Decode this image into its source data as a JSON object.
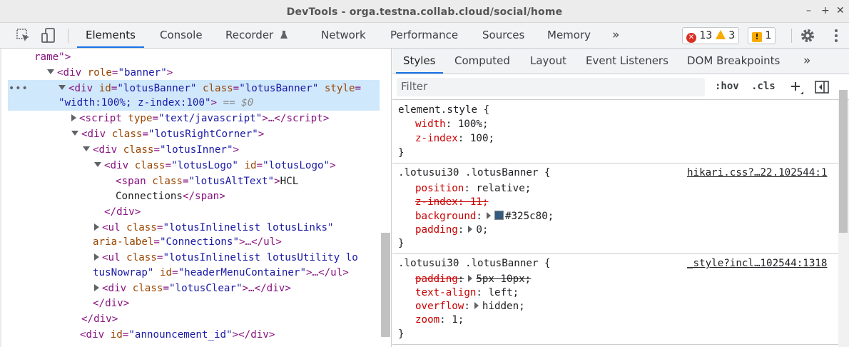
{
  "window": {
    "title": "DevTools - orga.testna.collab.cloud/social/home"
  },
  "toolbar": {
    "tabs": [
      "Elements",
      "Console",
      "Recorder",
      "Network",
      "Performance",
      "Sources",
      "Memory"
    ],
    "more": "»",
    "errors": "13",
    "warnings": "3",
    "issues": "1"
  },
  "elements": {
    "lines": {
      "l0": "rame\">",
      "banner_attr": "role",
      "banner_val": "\"banner\"",
      "sel_id_attr": "id",
      "sel_id_val": "\"lotusBanner\"",
      "sel_class_attr": "class",
      "sel_class_val": "\"lotusBanner\"",
      "sel_style_attr": "style",
      "sel_style_val": "\"width:100%; z-index:100\"",
      "sel_eq": "== $0",
      "script_attr": "type",
      "script_val": "\"text/javascript\"",
      "rc_val": "\"lotusRightCorner\"",
      "inner_val": "\"lotusInner\"",
      "logo_class": "\"lotusLogo\"",
      "logo_id": "\"lotusLogo\"",
      "span_class": "\"lotusAltText\"",
      "hcl_text_1": "HCL",
      "hcl_text_2": "Connections",
      "ul1_class": "\"lotusInlinelist lotusLinks\"",
      "ul1_aria": "aria-label",
      "ul1_aria_val": "\"Connections\"",
      "ul2_class_1": "\"lotusInlinelist lotusUtility lo",
      "ul2_class_2": "tusNowrap\"",
      "ul2_id": "\"headerMenuContainer\"",
      "clear_class": "\"lotusClear\"",
      "ann_id": "\"announcement_id\""
    }
  },
  "styles": {
    "tabs": [
      "Styles",
      "Computed",
      "Layout",
      "Event Listeners",
      "DOM Breakpoints"
    ],
    "more": "»",
    "filter_placeholder": "Filter",
    "hov": ":hov",
    "cls": ".cls",
    "rules": {
      "r1_sel": "element.style {",
      "r1_p1": "width",
      "r1_v1": "100%;",
      "r1_p2": "z-index",
      "r1_v2": "100;",
      "r2_sel": ".lotusui30 .lotusBanner {",
      "r2_src": "hikari.css?…22.102544:1",
      "r2_p1": "position",
      "r2_v1": "relative;",
      "r2_p2": "z-index: 11;",
      "r2_p3": "background",
      "r2_v3": "#325c80;",
      "r2_color": "#325c80",
      "r2_p4": "padding",
      "r2_v4": "0;",
      "r3_sel": ".lotusui30 .lotusBanner {",
      "r3_src": "_style?incl…102544:1318",
      "r3_p1": "padding",
      "r3_v1": "5px 10px;",
      "r3_p2": "text-align",
      "r3_v2": "left;",
      "r3_p3": "overflow",
      "r3_v3": "hidden;",
      "r3_p4": "zoom",
      "r3_v4": "1;",
      "close": "}"
    }
  }
}
